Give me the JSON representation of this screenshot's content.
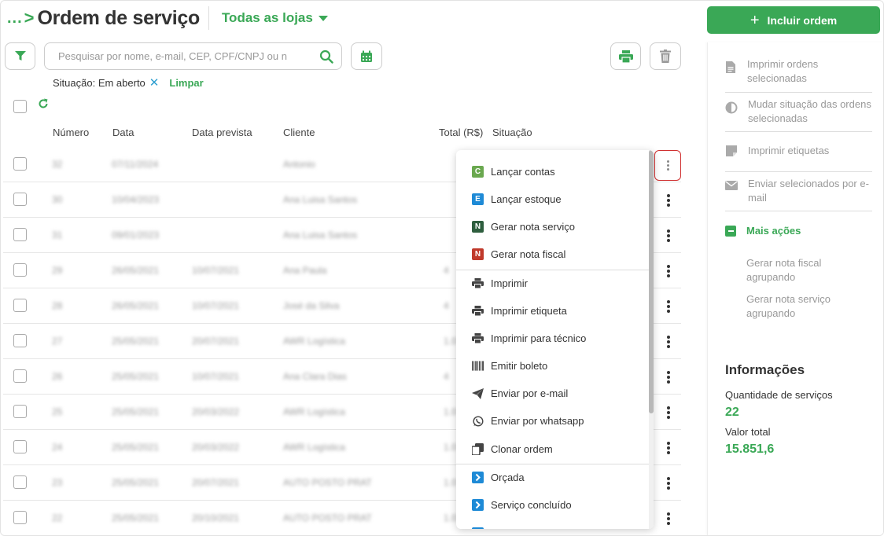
{
  "header": {
    "breadcrumb": "...",
    "title": "Ordem de serviço",
    "store_selector": "Todas as lojas",
    "add_button": "Incluir ordem"
  },
  "toolbar": {
    "search_placeholder": "Pesquisar por nome, e-mail, CEP, CPF/CNPJ ou n"
  },
  "filters": {
    "situacao": "Situação: Em aberto",
    "clear": "Limpar"
  },
  "table": {
    "columns": [
      "Número",
      "Data",
      "Data prevista",
      "Cliente",
      "Total (R$)",
      "Situação"
    ],
    "rows": [
      {
        "numero": "32",
        "data": "07/11/2024",
        "prevista": "",
        "cliente": "Antonio",
        "total": ""
      },
      {
        "numero": "30",
        "data": "10/04/2023",
        "prevista": "",
        "cliente": "Ana Luisa Santos",
        "total": ""
      },
      {
        "numero": "31",
        "data": "09/01/2023",
        "prevista": "",
        "cliente": "Ana Luisa Santos",
        "total": ""
      },
      {
        "numero": "29",
        "data": "26/05/2021",
        "prevista": "10/07/2021",
        "cliente": "Ana Paula",
        "total": "4"
      },
      {
        "numero": "28",
        "data": "26/05/2021",
        "prevista": "10/07/2021",
        "cliente": "José da Silva",
        "total": "4"
      },
      {
        "numero": "27",
        "data": "25/05/2021",
        "prevista": "20/07/2021",
        "cliente": "AWR Logística",
        "total": "1.0"
      },
      {
        "numero": "26",
        "data": "25/05/2021",
        "prevista": "10/07/2021",
        "cliente": "Ana Clara Dias",
        "total": "4"
      },
      {
        "numero": "25",
        "data": "25/05/2021",
        "prevista": "20/03/2022",
        "cliente": "AWR Logística",
        "total": "1.0"
      },
      {
        "numero": "24",
        "data": "25/05/2021",
        "prevista": "20/03/2022",
        "cliente": "AWR Logística",
        "total": "1.0"
      },
      {
        "numero": "23",
        "data": "25/05/2021",
        "prevista": "20/07/2021",
        "cliente": "AUTO POSTO PRAT",
        "total": "1.0"
      },
      {
        "numero": "22",
        "data": "25/05/2021",
        "prevista": "20/10/2021",
        "cliente": "AUTO POSTO PRAT",
        "total": "1.0"
      }
    ]
  },
  "menu": {
    "items": [
      {
        "label": "Lançar contas",
        "icon": "letter-c-icon",
        "letter": "C",
        "color": "#6aa84f"
      },
      {
        "label": "Lançar estoque",
        "icon": "letter-e-icon",
        "letter": "E",
        "color": "#1e8ad6"
      },
      {
        "label": "Gerar nota serviço",
        "icon": "letter-n-icon",
        "letter": "N",
        "color": "#2e5e3e"
      },
      {
        "label": "Gerar nota fiscal",
        "icon": "letter-n-icon",
        "letter": "N",
        "color": "#c0392b"
      },
      {
        "label": "Imprimir",
        "icon": "printer-icon"
      },
      {
        "label": "Imprimir etiqueta",
        "icon": "printer-icon"
      },
      {
        "label": "Imprimir para técnico",
        "icon": "printer-icon"
      },
      {
        "label": "Emitir boleto",
        "icon": "barcode-icon"
      },
      {
        "label": "Enviar por e-mail",
        "icon": "paper-plane-icon"
      },
      {
        "label": "Enviar por whatsapp",
        "icon": "whatsapp-icon"
      },
      {
        "label": "Clonar ordem",
        "icon": "clone-icon"
      },
      {
        "label": "Orçada",
        "icon": "chevron-right-icon",
        "color": "#1e8ad6"
      },
      {
        "label": "Serviço concluído",
        "icon": "chevron-right-icon",
        "color": "#1e8ad6"
      }
    ]
  },
  "side": {
    "actions": [
      {
        "label": "Imprimir ordens selecionadas",
        "icon": "document-icon"
      },
      {
        "label": "Mudar situação das ordens selecionadas",
        "icon": "half-circle-icon"
      },
      {
        "label": "Imprimir etiquetas",
        "icon": "label-icon"
      },
      {
        "label": "Enviar selecionados por e-mail",
        "icon": "envelope-icon"
      }
    ],
    "more_actions": "Mais ações",
    "more_items": [
      "Gerar nota fiscal agrupando",
      "Gerar nota serviço agrupando"
    ],
    "info_title": "Informações",
    "qty_label": "Quantidade de serviços",
    "qty_value": "22",
    "total_label": "Valor total",
    "total_value": "15.851,6"
  },
  "colors": {
    "accent": "#3aa856",
    "highlight": "#d03030",
    "info_blue": "#1e8ad6"
  }
}
